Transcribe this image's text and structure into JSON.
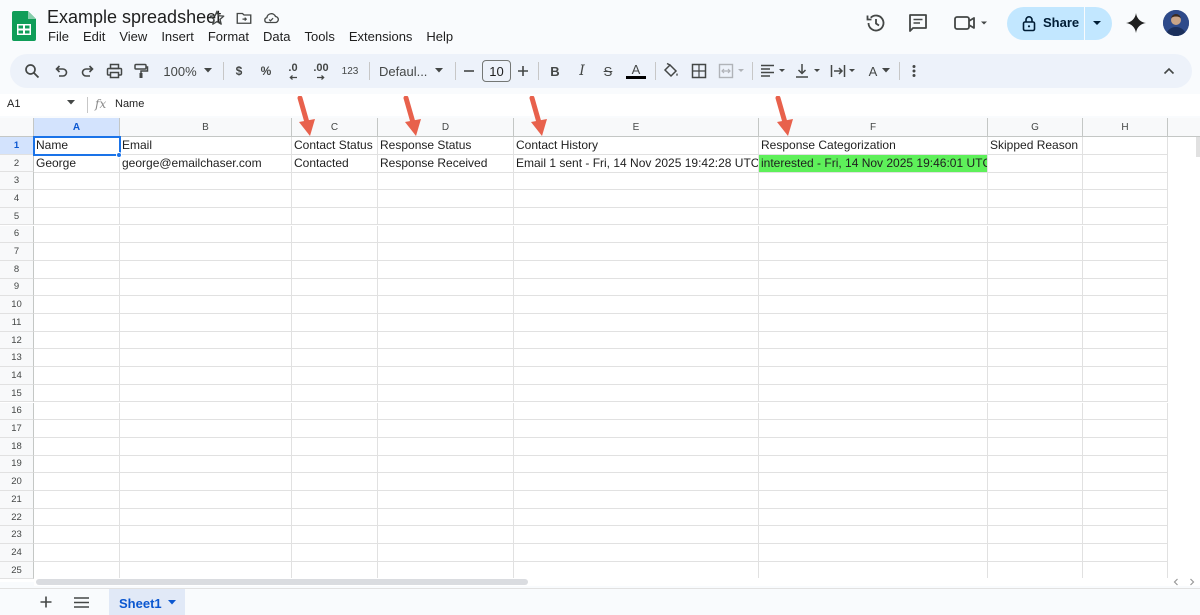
{
  "app": {
    "title": "Example spreadsheet",
    "menus": [
      "File",
      "Edit",
      "View",
      "Insert",
      "Format",
      "Data",
      "Tools",
      "Extensions",
      "Help"
    ]
  },
  "header": {
    "share_label": "Share"
  },
  "toolbar": {
    "zoom": "100%",
    "currency": "$",
    "percent": "%",
    "decrease_decimal": ".0",
    "increase_decimal": ".00",
    "number_format": "123",
    "font": "Defaul...",
    "font_size": "10",
    "bold": "B",
    "italic": "I",
    "strikethrough": "S",
    "text_color": "A",
    "text_rotation": "A"
  },
  "formula_bar": {
    "cell_ref": "A1",
    "fx": "fx",
    "content": "Name"
  },
  "columns": [
    "A",
    "B",
    "C",
    "D",
    "E",
    "F",
    "G",
    "H"
  ],
  "rows": [
    "1",
    "2",
    "3",
    "4",
    "5",
    "6",
    "7",
    "8",
    "9",
    "10",
    "11",
    "12",
    "13",
    "14",
    "15",
    "16",
    "17",
    "18",
    "19",
    "20",
    "21",
    "22",
    "23",
    "24",
    "25"
  ],
  "cells": {
    "A1": "Name",
    "B1": "Email",
    "C1": "Contact Status",
    "D1": "Response Status",
    "E1": "Contact History",
    "F1": "Response Categorization",
    "G1": "Skipped Reason",
    "A2": "George",
    "B2": "george@emailchaser.com",
    "C2": "Contacted",
    "D2": "Response Received",
    "E2": "Email 1 sent - Fri, 14 Nov 2025 19:42:28 UTC",
    "F2": "interested - Fri, 14 Nov 2025 19:46:01 UTC"
  },
  "colors": {
    "highlight_green": "#5ef05a",
    "arrow_red": "#e8614c",
    "selection_blue": "#1a73e8"
  },
  "sheets": {
    "active": "Sheet1"
  }
}
